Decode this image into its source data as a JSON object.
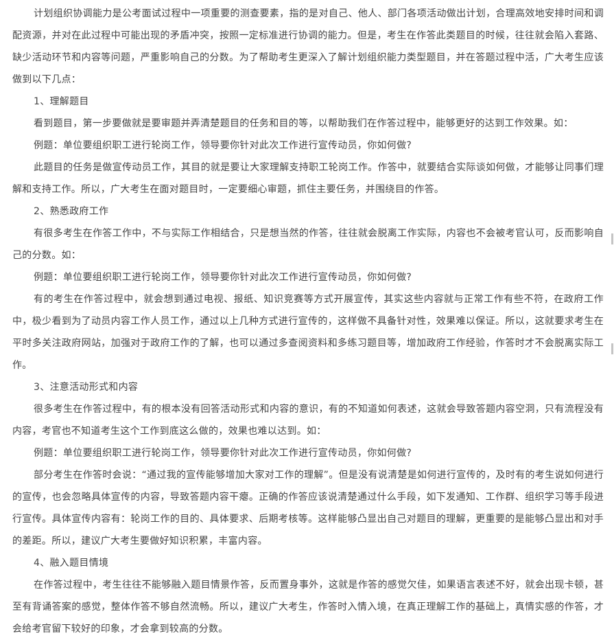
{
  "article": {
    "paragraphs": [
      "计划组织协调能力是公考面试过程中一项重要的测查要素，指的是对自己、他人、部门各项活动做出计划，合理高效地安排时间和调配资源，并对在此过程中可能出现的矛盾冲突，按照一定标准进行协调的能力。但是，考生在作答此类题目的时候，往往就会陷入套路、缺少活动环节和内容等问题，严重影响自己的分数。为了帮助考生更深入了解计划组织能力类型题目，并在答题过程中活，广大考生应该做到以下几点：",
      "1、理解题目",
      "看到题目，第一步要做就是要审题并弄清楚题目的任务和目的等，以帮助我们在作答过程中，能够更好的达到工作效果。如：",
      "例题：单位要组织职工进行轮岗工作，领导要你针对此次工作进行宣传动员，你如何做?",
      "此题目的任务是做宣传动员工作，其目的就是要让大家理解支持职工轮岗工作。作答中，就要结合实际谈如何做，才能够让同事们理解和支持工作。所以，广大考生在面对题目时，一定要细心审题，抓住主要任务，并围绕目的作答。",
      "2、熟悉政府工作",
      "有很多考生在作答工作中，不与实际工作相结合，只是想当然的作答，往往就会脱离工作实际，内容也不会被考官认可，反而影响自己的分数。如：",
      "例题：单位要组织职工进行轮岗工作，领导要你针对此次工作进行宣传动员，你如何做?",
      "有的考生在作答过程中，就会想到通过电视、报纸、知识竞赛等方式开展宣传，其实这些内容就与正常工作有些不符，在政府工作中，极少看到为了动员内容工作人员工作，通过以上几种方式进行宣传的，这样做不具备针对性，效果难以保证。所以，这就要求考生在平时多关注政府网站，加强对于政府工作的了解，也可以通过多查阅资料和多练习题目等，增加政府工作经验，作答时才不会脱离实际工作。",
      "3、注意活动形式和内容",
      "很多考生在作答过程中，有的根本没有回答活动形式和内容的意识，有的不知道如何表述，这就会导致答题内容空洞，只有流程没有内容，考官也不知道考生这个工作到底这么做的，效果也难以达到。如：",
      "例题：单位要组织职工进行轮岗工作，领导要你针对此次工作进行宣传动员，你如何做?",
      "部分考生在作答时会说：“通过我的宣传能够增加大家对工作的理解”。但是没有说清楚是如何进行宣传的，及时有的考生说如何进行的宣传，也会忽略具体宣传的内容，导致答题内容干瘪。正确的作答应该说清楚通过什么手段，如下发通知、工作群、组织学习等手段进行宣传。具体宣传内容有：轮岗工作的目的、具体要求、后期考核等。这样能够凸显出自己对题目的理解，更重要的是能够凸显出和对手的差距。所以，建议广大考生要做好知识积累，丰富内容。",
      "4、融入题目情境",
      "在作答过程中，考生往往不能够融入题目情景作答，反而置身事外，这就是作答的感觉欠佳，如果语言表述不好，就会出现卡顿，甚至有背诵答案的感觉，整体作答不够自然流畅。所以，建议广大考生，作答时入情入境，在真正理解工作的基础上，真情实感的作答，才会给考官留下较好的印象，才会拿到较高的分数。"
    ]
  }
}
